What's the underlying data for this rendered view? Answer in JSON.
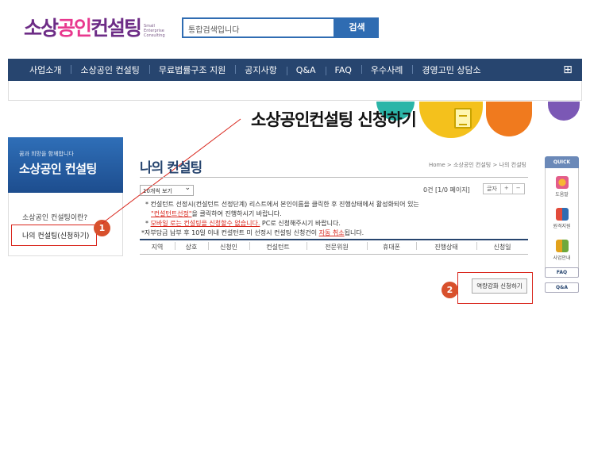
{
  "header": {
    "logo_text_a": "소상",
    "logo_text_b": "공인",
    "logo_text_c": "컨설팅",
    "logo_sub": "Small Enterprise Consulting",
    "search_placeholder": "통합검색입니다",
    "search_button": "검색"
  },
  "nav": {
    "items": [
      "사업소개",
      "소상공인 컨설팅",
      "무료법률구조 지원",
      "공지사항",
      "Q&A",
      "FAQ",
      "우수사례",
      "경영고민 상담소"
    ]
  },
  "annotation": {
    "title": "소상공인컨설팅 신청하기",
    "badge1": "1",
    "badge2": "2"
  },
  "sidebar": {
    "tagline": "꿈과 희망을 함께합니다",
    "title": "소상공인 컨설팅",
    "link1": "소상공인 컨설팅이란?",
    "link2": "나의 컨설팅(신청하기)"
  },
  "content": {
    "page_title": "나의 컨설팅",
    "breadcrumb": "Home > 소상공인 컨설팅 > 나의 컨설팅",
    "perpage": "10개씩 보기",
    "count": "0건 [1/0 페이지]",
    "font_label": "글자",
    "font_plus": "+",
    "font_minus": "−",
    "notice1": "* 컨설턴트 선정시(컨설턴트 선정단계) 리스트에서 본인이름을 클릭한 후 진행상태에서 활성화되어 있는",
    "notice2_link": "\"컨설턴트선정\"",
    "notice2_rest": "을 클릭하여 진행하시기 바랍니다.",
    "notice3_prefix": "* ",
    "notice3_link": "모바일 로는 컨설팅을 신청할수 없습니다.",
    "notice3_rest": " PC로 신청해주시기 바랍니다.",
    "notice4_a": "*자부담금 납부 후 10일 이내 컨설턴트 미 선정시 컨설팅 신청건이 ",
    "notice4_link": "자동 취소",
    "notice4_b": "됩니다.",
    "columns": [
      "지역",
      "상호",
      "신청인",
      "컨설턴트",
      "전문위원",
      "휴대폰",
      "진행상태",
      "신청일"
    ],
    "apply_button": "역량강화 신청하기"
  },
  "quick": {
    "head": "QUICK",
    "item1": "도움말",
    "item2": "원격지원",
    "item3": "사업안내",
    "faq": "FAQ",
    "qna": "Q&A"
  },
  "colors": {
    "nav_bg": "#27456f",
    "brand_purple": "#6d2c86",
    "brand_pink": "#e8388e",
    "accent_red": "#d9261c",
    "badge": "#d8502c"
  }
}
